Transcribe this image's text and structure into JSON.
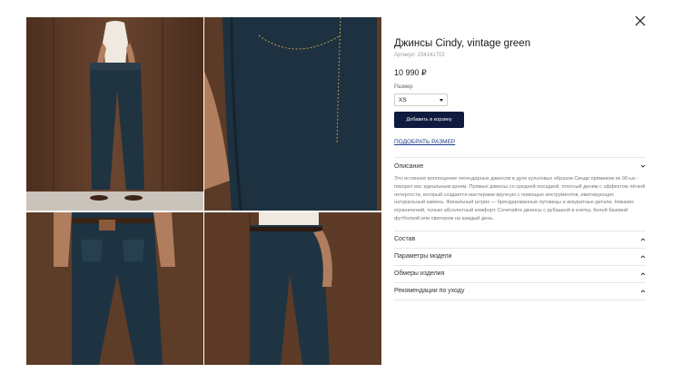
{
  "product": {
    "title": "Джинсы Cindy, vintage green",
    "sku": "Артикул: 234141702",
    "price": "10 990 ₽",
    "size_label": "Размер",
    "size_selected": "XS",
    "add_to_cart": "Добавить в корзину",
    "size_guide_link": "ПОДОБРАТЬ РАЗМЕР"
  },
  "accordion": {
    "description": {
      "title": "Описание",
      "text": "Это истинное воплощение легендарных джинсов в духе культовых образов Синди прямиком из 90-ых - покорит вас идеальным кроем. Прямые джинсы со средней посадкой, плотный деним с эффектом лёгкой потертости, который создается мастерами вручную с помощью инструментов, имитирующих натуральный камень. Финальный штрих — брендированные пуговицы и аккуратные детали. Никаких ограничений, только абсолютный комфорт. Сочетайте джинсы с рубашкой в клетку, белой базовой футболкой или свитером на каждый день."
    },
    "items": [
      {
        "title": "Состав"
      },
      {
        "title": "Параметры модели"
      },
      {
        "title": "Обмеры изделия"
      },
      {
        "title": "Рекомендации по уходу"
      }
    ]
  },
  "icons": {
    "close": "close-icon",
    "caret": "caret-down-icon",
    "chevron_open": "chevron-down-icon",
    "chevron_closed": "chevron-up-icon"
  },
  "colors": {
    "button_bg": "#0e1a3e",
    "link": "#1c3a8a",
    "wood": "#5a3a26",
    "denim": "#1f3340"
  }
}
